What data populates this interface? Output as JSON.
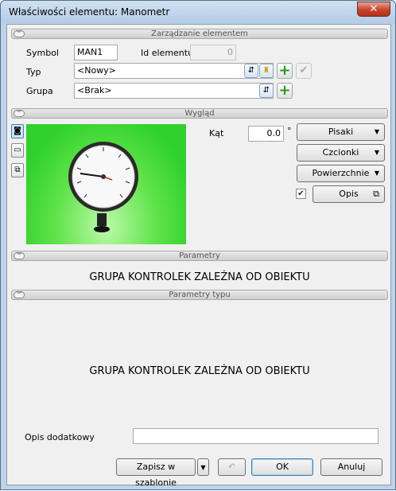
{
  "window": {
    "title": "Właściwości elementu: Manometr",
    "close_glyph": "✕"
  },
  "sections": {
    "management": "Zarządzanie elementem",
    "appearance": "Wygląd",
    "parameters": "Parametry",
    "type_parameters": "Parametry typu"
  },
  "management": {
    "symbol_label": "Symbol",
    "symbol_value": "MAN1",
    "id_label": "Id elementu",
    "id_value": "0",
    "type_label": "Typ",
    "type_value": "<Nowy>",
    "group_label": "Grupa",
    "group_value": "<Brak>"
  },
  "appearance": {
    "angle_label": "Kąt",
    "angle_value": "0.0",
    "angle_unit": "°",
    "pens_label": "Pisaki",
    "fonts_label": "Czcionki",
    "surfaces_label": "Powierzchnie",
    "description_label": "Opis",
    "description_checked": true,
    "preview_bg": "#3fd93a"
  },
  "parameters": {
    "placeholder": "GRUPA KONTROLEK ZALEŻNA OD OBIEKTU"
  },
  "type_parameters": {
    "placeholder": "GRUPA KONTROLEK ZALEŻNA OD OBIEKTU"
  },
  "footer": {
    "extra_desc_label": "Opis dodatkowy",
    "extra_desc_value": "",
    "save_template_label": "Zapisz w szablonie",
    "ok_label": "OK",
    "cancel_label": "Anuluj"
  },
  "icons": [
    "close-icon",
    "collapse-chevron-icon",
    "browse-icon",
    "lock-icon",
    "add-icon",
    "confirm-check-icon",
    "camera-view-icon",
    "folder-icon",
    "layers-icon",
    "dropdown-arrow-icon",
    "undo-icon",
    "external-window-icon",
    "gauge-image"
  ]
}
